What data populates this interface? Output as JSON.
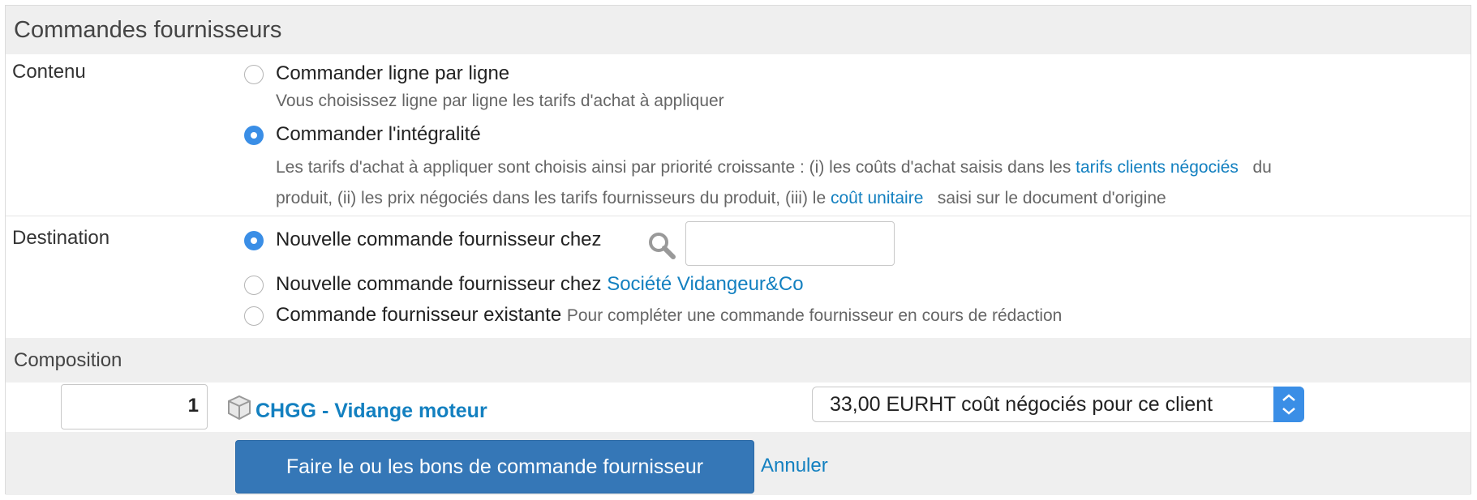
{
  "section_title": "Commandes fournisseurs",
  "contenu": {
    "label": "Contenu",
    "options": [
      {
        "label": "Commander ligne par ligne",
        "help": "Vous choisissez ligne par ligne les tarifs d'achat à appliquer",
        "selected": false
      },
      {
        "label": "Commander l'intégralité",
        "selected": true
      }
    ],
    "help2": {
      "p1": "Les tarifs d'achat à appliquer sont choisis ainsi par priorité croissante : (i) les coûts d'achat saisis dans les",
      "link1": "tarifs clients négociés",
      "p2": "du",
      "p3": "produit, (ii) les prix négociés dans les tarifs fournisseurs du produit, (iii) le",
      "link2": "coût unitaire",
      "p4": "saisi sur le document d'origine"
    }
  },
  "destination": {
    "label": "Destination",
    "option1": "Nouvelle commande fournisseur chez",
    "option2": "Nouvelle commande fournisseur chez",
    "option2_link": "Société Vidangeur&Co",
    "option3": "Commande fournisseur existante",
    "option3_help": "Pour compléter une commande fournisseur en cours de rédaction",
    "search_value": ""
  },
  "composition": {
    "title": "Composition",
    "quantity": "1",
    "product": "CHGG - Vidange moteur",
    "price_select": "33,00 EURHT coût négociés pour ce client",
    "product_icon": "box-icon"
  },
  "actions": {
    "submit": "Faire le ou les bons de commande fournisseur",
    "cancel": "Annuler"
  }
}
